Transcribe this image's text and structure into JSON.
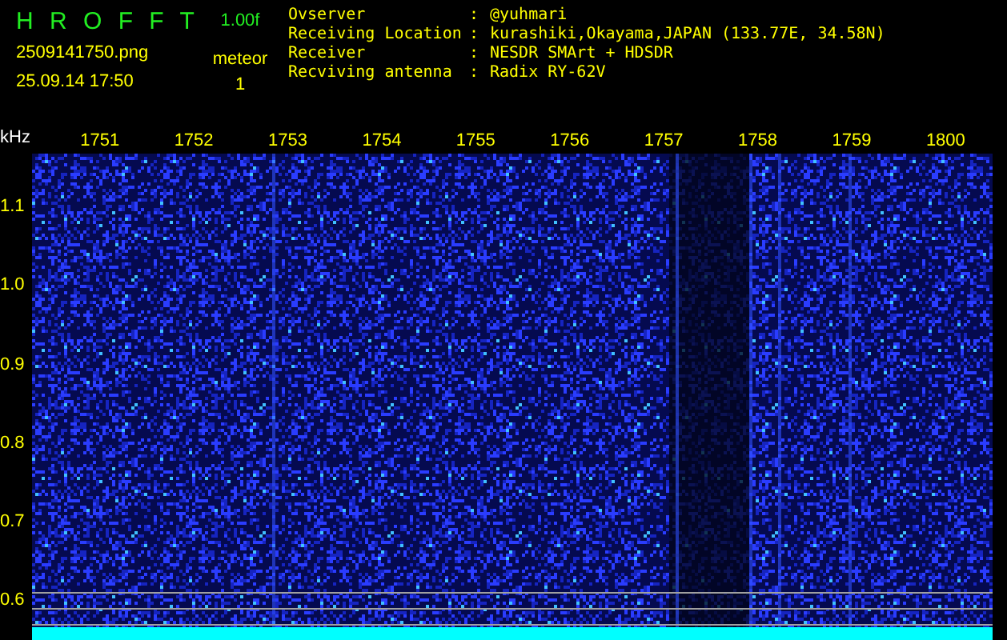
{
  "header": {
    "title": "H R O F F T",
    "version": "1.00f",
    "filename": "2509141750.png",
    "datetime": "25.09.14 17:50",
    "event_label": "meteor",
    "event_count": "1"
  },
  "station_info": [
    {
      "label": "Ovserver",
      "separator": ":",
      "value": "@yuhmari"
    },
    {
      "label": "Receiving Location",
      "separator": ":",
      "value": "kurashiki,Okayama,JAPAN (133.77E, 34.58N)"
    },
    {
      "label": "Receiver",
      "separator": ":",
      "value": "NESDR SMArt + HDSDR"
    },
    {
      "label": "Recviving antenna",
      "separator": ":",
      "value": "Radix RY-62V"
    }
  ],
  "y_axis": {
    "unit": "kHz",
    "labels": [
      "1.1",
      "1.0",
      "0.9",
      "0.8",
      "0.7",
      "0.6"
    ]
  },
  "x_axis": {
    "labels": [
      "1751",
      "1752",
      "1753",
      "1754",
      "1755",
      "1756",
      "1757",
      "1758",
      "1759",
      "1800"
    ]
  }
}
